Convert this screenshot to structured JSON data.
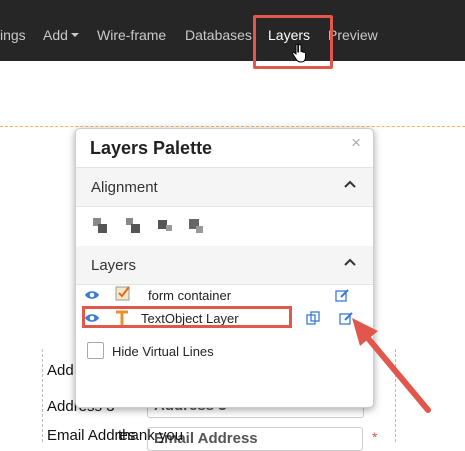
{
  "nav": {
    "items": [
      {
        "label": "ings"
      },
      {
        "label": "Add"
      },
      {
        "label": "Wire-frame"
      },
      {
        "label": "Databases"
      },
      {
        "label": "Layers"
      },
      {
        "label": "Preview"
      }
    ],
    "active": "Layers"
  },
  "palette": {
    "title": "Layers Palette",
    "close_glyph": "×",
    "alignment": {
      "title": "Alignment"
    },
    "layers": {
      "title": "Layers",
      "items": [
        {
          "name": "form container"
        },
        {
          "name": "TextObject Layer"
        }
      ]
    },
    "hide_virtual_lines": {
      "label": "Hide Virtual Lines",
      "checked": false
    }
  },
  "background_form": {
    "labels": [
      "Add",
      "Address 3",
      "Email Addres"
    ],
    "inputs": [
      "Address 3",
      "Email Address"
    ],
    "overlap_text": "thank you",
    "required_mark": "*"
  },
  "colors": {
    "nav_bg": "#262626",
    "highlight": "#e2574c",
    "guide": "#f5b25b",
    "icon_blue": "#3a7bd5"
  }
}
